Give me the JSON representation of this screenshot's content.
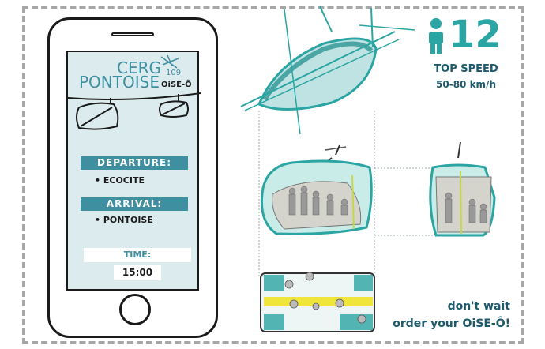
{
  "app": {
    "logo_line1": "CERG",
    "logo_line2": "PONTOISE",
    "logo_number": "109",
    "logo_brand": "OiSE-Ô"
  },
  "trip": {
    "departure_label": "DEPARTURE:",
    "departure_value": "• ECOCITE",
    "arrival_label": "ARRIVAL:",
    "arrival_value": "• PONTOISE",
    "time_label": "TIME:",
    "time_value": "15:00"
  },
  "speed": {
    "capacity": "12",
    "title": "TOP SPEED",
    "range": "50-80 km/h"
  },
  "cta": {
    "line1": "don't wait",
    "line2": "order your OiSE-Ô!"
  },
  "colors": {
    "teal": "#2aa5a3",
    "label_blue": "#3e8fa0",
    "dark_blue": "#1e5a6d",
    "screen_bg": "#dcebee"
  }
}
